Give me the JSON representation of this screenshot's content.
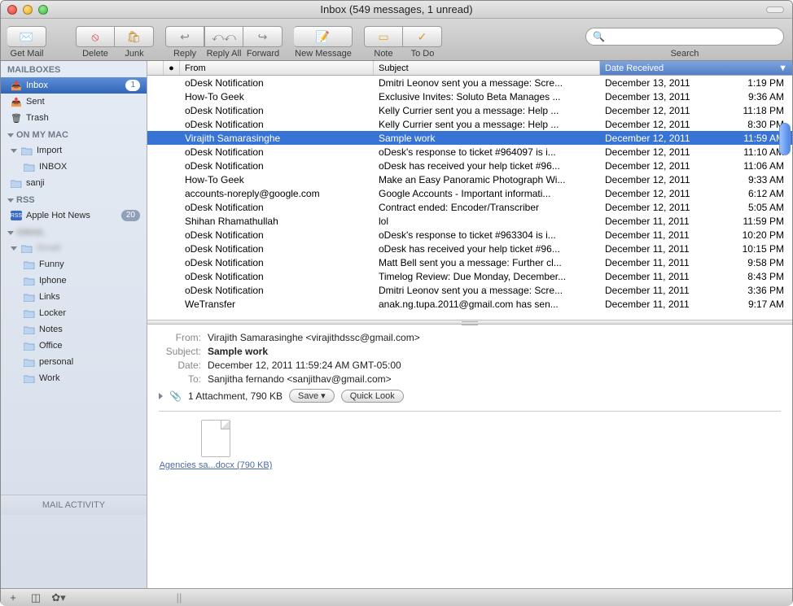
{
  "window": {
    "title": "Inbox (549 messages, 1 unread)"
  },
  "toolbar": {
    "get_mail": "Get Mail",
    "delete": "Delete",
    "junk": "Junk",
    "reply": "Reply",
    "reply_all": "Reply All",
    "forward": "Forward",
    "new_message": "New Message",
    "note": "Note",
    "todo": "To Do",
    "search": "Search"
  },
  "sidebar": {
    "sections": {
      "mailboxes": "MAILBOXES",
      "on_my_mac": "ON MY MAC",
      "rss": "RSS"
    },
    "inbox": {
      "label": "Inbox",
      "badge": "1"
    },
    "sent": "Sent",
    "trash": "Trash",
    "import": "Import",
    "import_inbox": "INBOX",
    "sanji": "sanji",
    "apple_hot_news": {
      "label": "Apple Hot News",
      "badge": "20"
    },
    "folders": [
      "Funny",
      "Iphone",
      "Links",
      "Locker",
      "Notes",
      "Office",
      "personal",
      "Work"
    ],
    "activity": "MAIL ACTIVITY"
  },
  "columns": {
    "from": "From",
    "subject": "Subject",
    "date": "Date Received"
  },
  "messages": [
    {
      "from": "oDesk Notification",
      "subject": "Dmitri Leonov sent you a message: Scre...",
      "date": "December 13, 2011",
      "time": "1:19 PM"
    },
    {
      "from": "How-To Geek",
      "subject": "Exclusive Invites: Soluto Beta Manages ...",
      "date": "December 13, 2011",
      "time": "9:36 AM"
    },
    {
      "from": "oDesk Notification",
      "subject": "Kelly Currier sent you a message: Help ...",
      "date": "December 12, 2011",
      "time": "11:18 PM"
    },
    {
      "from": "oDesk Notification",
      "subject": "Kelly Currier sent you a message: Help ...",
      "date": "December 12, 2011",
      "time": "8:30 PM"
    },
    {
      "from": "Virajith Samarasinghe",
      "subject": "Sample work",
      "date": "December 12, 2011",
      "time": "11:59 AM",
      "selected": true
    },
    {
      "from": "oDesk Notification",
      "subject": "oDesk's response to ticket #964097 is i...",
      "date": "December 12, 2011",
      "time": "11:10 AM"
    },
    {
      "from": "oDesk Notification",
      "subject": "oDesk has received your help ticket #96...",
      "date": "December 12, 2011",
      "time": "11:06 AM"
    },
    {
      "from": "How-To Geek",
      "subject": "Make an Easy Panoramic Photograph Wi...",
      "date": "December 12, 2011",
      "time": "9:33 AM"
    },
    {
      "from": "accounts-noreply@google.com",
      "subject": "Google Accounts - Important informati...",
      "date": "December 12, 2011",
      "time": "6:12 AM"
    },
    {
      "from": "oDesk Notification",
      "subject": "Contract ended: Encoder/Transcriber",
      "date": "December 12, 2011",
      "time": "5:05 AM"
    },
    {
      "from": "Shihan Rhamathullah",
      "subject": "lol",
      "date": "December 11, 2011",
      "time": "11:59 PM"
    },
    {
      "from": "oDesk Notification",
      "subject": "oDesk's response to ticket #963304 is i...",
      "date": "December 11, 2011",
      "time": "10:20 PM"
    },
    {
      "from": "oDesk Notification",
      "subject": "oDesk has received your help ticket #96...",
      "date": "December 11, 2011",
      "time": "10:15 PM"
    },
    {
      "from": "oDesk Notification",
      "subject": "Matt Bell sent you a message: Further cl...",
      "date": "December 11, 2011",
      "time": "9:58 PM"
    },
    {
      "from": "oDesk Notification",
      "subject": "Timelog Review: Due Monday, December...",
      "date": "December 11, 2011",
      "time": "8:43 PM"
    },
    {
      "from": "oDesk Notification",
      "subject": "Dmitri Leonov sent you a message: Scre...",
      "date": "December 11, 2011",
      "time": "3:36 PM"
    },
    {
      "from": "WeTransfer",
      "subject": "anak.ng.tupa.2011@gmail.com has sen...",
      "date": "December 11, 2011",
      "time": "9:17 AM"
    }
  ],
  "preview": {
    "from_label": "From:",
    "from_value": "Virajith Samarasinghe <virajithdssc@gmail.com>",
    "subject_label": "Subject:",
    "subject_value": "Sample work",
    "date_label": "Date:",
    "date_value": "December 12, 2011 11:59:24 AM GMT-05:00",
    "to_label": "To:",
    "to_value": "Sanjitha fernando <sanjithav@gmail.com>",
    "attachment_summary": "1 Attachment, 790 KB",
    "save_btn": "Save ▾",
    "quicklook_btn": "Quick Look",
    "attachment_name": "Agencies sa...docx (790 KB)"
  }
}
